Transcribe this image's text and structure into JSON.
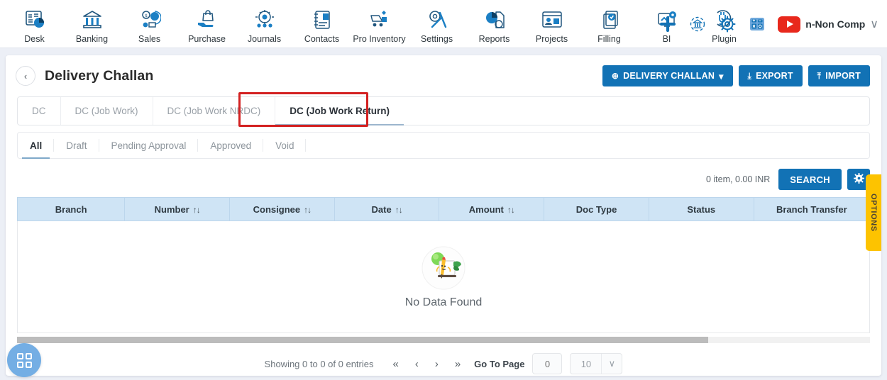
{
  "topnav": {
    "items": [
      {
        "label": "Desk",
        "icon": "dashboard-icon"
      },
      {
        "label": "Banking",
        "icon": "bank-icon"
      },
      {
        "label": "Sales",
        "icon": "sales-icon"
      },
      {
        "label": "Purchase",
        "icon": "purchase-icon"
      },
      {
        "label": "Journals",
        "icon": "journals-icon"
      },
      {
        "label": "Contacts",
        "icon": "contacts-icon"
      },
      {
        "label": "Pro Inventory",
        "icon": "inventory-icon"
      },
      {
        "label": "Settings",
        "icon": "settings-icon"
      },
      {
        "label": "Reports",
        "icon": "reports-icon"
      },
      {
        "label": "Projects",
        "icon": "projects-icon"
      },
      {
        "label": "Filling",
        "icon": "filling-icon"
      },
      {
        "label": "BI",
        "icon": "bi-icon"
      },
      {
        "label": "Plugin",
        "icon": "plugin-icon"
      }
    ],
    "right_icons": [
      {
        "name": "add-icon"
      },
      {
        "name": "bank-sync-icon"
      },
      {
        "name": "gear-icon"
      },
      {
        "name": "calculator-icon"
      },
      {
        "name": "youtube-icon"
      }
    ],
    "account_name": "n-Non Comp",
    "account_chevron": "∨"
  },
  "page": {
    "back_arrow": "‹",
    "title": "Delivery Challan",
    "actions": [
      {
        "label": "DELIVERY CHALLAN",
        "glyph": "⊕",
        "caret": "▾",
        "name": "delivery-challan-button"
      },
      {
        "label": "EXPORT",
        "glyph": "⤓",
        "name": "export-button"
      },
      {
        "label": "IMPORT",
        "glyph": "⤒",
        "name": "import-button"
      }
    ]
  },
  "doc_tabs": [
    {
      "label": "DC",
      "active": false
    },
    {
      "label": "DC (Job Work)",
      "active": false
    },
    {
      "label": "DC (Job Work NRDC)",
      "active": false
    },
    {
      "label": "DC (Job Work Return)",
      "active": true
    }
  ],
  "status_tabs": [
    {
      "label": "All",
      "active": true
    },
    {
      "label": "Draft",
      "active": false
    },
    {
      "label": "Pending Approval",
      "active": false
    },
    {
      "label": "Approved",
      "active": false
    },
    {
      "label": "Void",
      "active": false
    }
  ],
  "search_row": {
    "item_summary": "0 item, 0.00 INR",
    "search_label": "SEARCH",
    "settings_icon": "gear-icon"
  },
  "table": {
    "columns": [
      {
        "label": "Branch",
        "sortable": false
      },
      {
        "label": "Number",
        "sortable": true
      },
      {
        "label": "Consignee",
        "sortable": true
      },
      {
        "label": "Date",
        "sortable": true
      },
      {
        "label": "Amount",
        "sortable": true
      },
      {
        "label": "Doc Type",
        "sortable": false
      },
      {
        "label": "Status",
        "sortable": false
      },
      {
        "label": "Branch Transfer",
        "sortable": false
      }
    ],
    "sort_glyph": "↑↓",
    "rows": [],
    "empty_message": "No Data Found",
    "empty_illustration": "no-data-illustration"
  },
  "pagination": {
    "showing": "Showing 0 to 0 of 0 entries",
    "first": "«",
    "prev": "‹",
    "next": "›",
    "last": "»",
    "go_to_page_label": "Go To Page",
    "page_value": "0",
    "page_placeholder": "0",
    "page_size": "10",
    "page_size_caret": "∨"
  },
  "options_tab": {
    "label": "OPTIONS"
  },
  "fab": {
    "icon": "grid-apps-icon"
  },
  "colors": {
    "accent_blue": "#1272b5",
    "header_blue": "#cfe4f5",
    "options_yellow": "#fdc300",
    "highlight_red": "#d32121",
    "page_bg": "#eceff6",
    "fab_blue": "#74aee4"
  }
}
